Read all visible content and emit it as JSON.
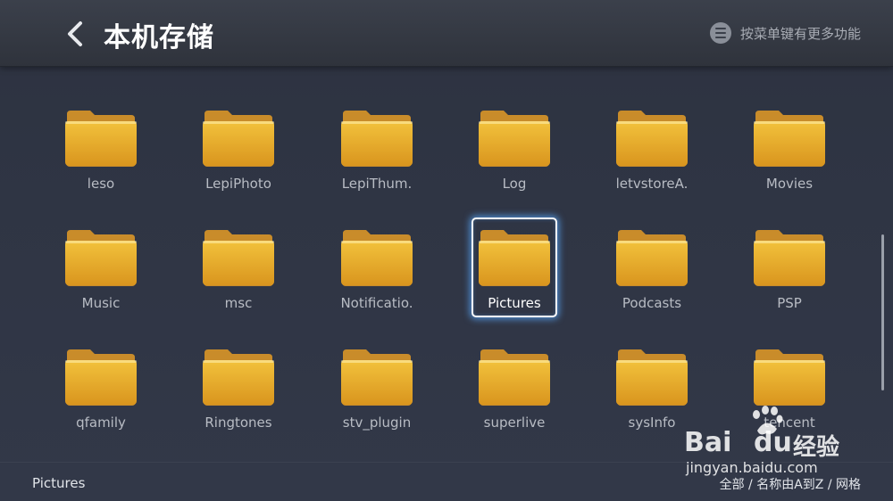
{
  "header": {
    "title": "本机存储",
    "back_icon": "chevron-left-icon",
    "menu_icon": "menu-icon",
    "menu_hint": "按菜单键有更多功能"
  },
  "folders": [
    {
      "label": "leso"
    },
    {
      "label": "LepiPhoto"
    },
    {
      "label": "LepiThum."
    },
    {
      "label": "Log"
    },
    {
      "label": "letvstoreA."
    },
    {
      "label": "Movies"
    },
    {
      "label": "Music"
    },
    {
      "label": "msc"
    },
    {
      "label": "Notificatio."
    },
    {
      "label": "Pictures",
      "selected": true
    },
    {
      "label": "Podcasts"
    },
    {
      "label": "PSP"
    },
    {
      "label": "qfamily"
    },
    {
      "label": "Ringtones"
    },
    {
      "label": "stv_plugin"
    },
    {
      "label": "superlive"
    },
    {
      "label": "sysInfo"
    },
    {
      "label": "tencent"
    }
  ],
  "footer": {
    "current_folder": "Pictures",
    "view_options": "全部 / 名称由A到Z / 网格"
  },
  "watermark": {
    "brand": "Bai",
    "brand2": "du",
    "cn": "经验",
    "url": "jingyan.baidu.com"
  },
  "colors": {
    "folder_top": "#f2c23c",
    "folder_bottom": "#d9951e",
    "folder_tab": "#c98c2a",
    "selection_glow": "#5aaaff",
    "background": "#2f3544"
  }
}
